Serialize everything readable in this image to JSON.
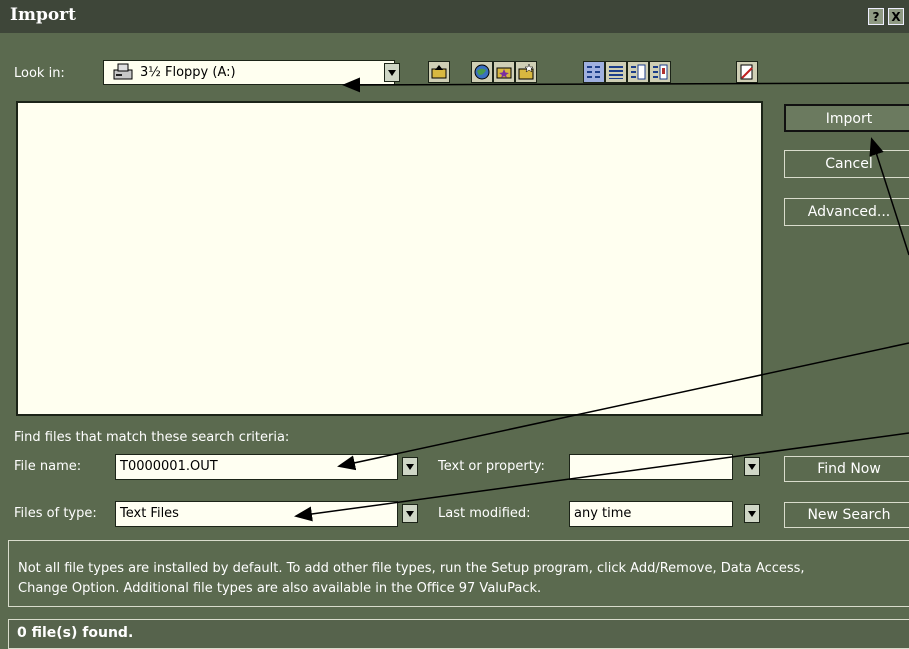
{
  "window": {
    "title": "Import"
  },
  "title_buttons": {
    "help": "?",
    "close": "X"
  },
  "look_in": {
    "label": "Look in:",
    "value": "3½ Floppy (A:)"
  },
  "buttons": {
    "import": "Import",
    "cancel": "Cancel",
    "advanced": "Advanced...",
    "find_now": "Find Now",
    "new_search": "New Search"
  },
  "search": {
    "criteria_label": "Find files that match these search criteria:",
    "file_name_label": "File name:",
    "file_name_value": "T0000001.OUT",
    "files_of_type_label": "Files of type:",
    "files_of_type_value": "Text Files",
    "text_property_label": "Text or property:",
    "text_property_value": "",
    "last_modified_label": "Last modified:",
    "last_modified_value": "any time"
  },
  "info": {
    "line1": "Not all file types are installed by default.  To add other file types, run the Setup program, click Add/Remove, Data Access,",
    "line2": "Change Option.  Additional file types are also available in the Office 97 ValuPack."
  },
  "status": {
    "text": "0 file(s) found."
  },
  "toolbar_icons": [
    "up-one-level-icon",
    "search-web-icon",
    "look-in-favorites-icon",
    "add-to-favorites-icon",
    "list-view-icon",
    "details-view-icon",
    "properties-view-icon",
    "preview-view-icon",
    "commands-settings-icon"
  ],
  "colors": {
    "background": "#5b6a4f",
    "titlebar": "#3e4639",
    "list_bg": "#fffff0"
  }
}
